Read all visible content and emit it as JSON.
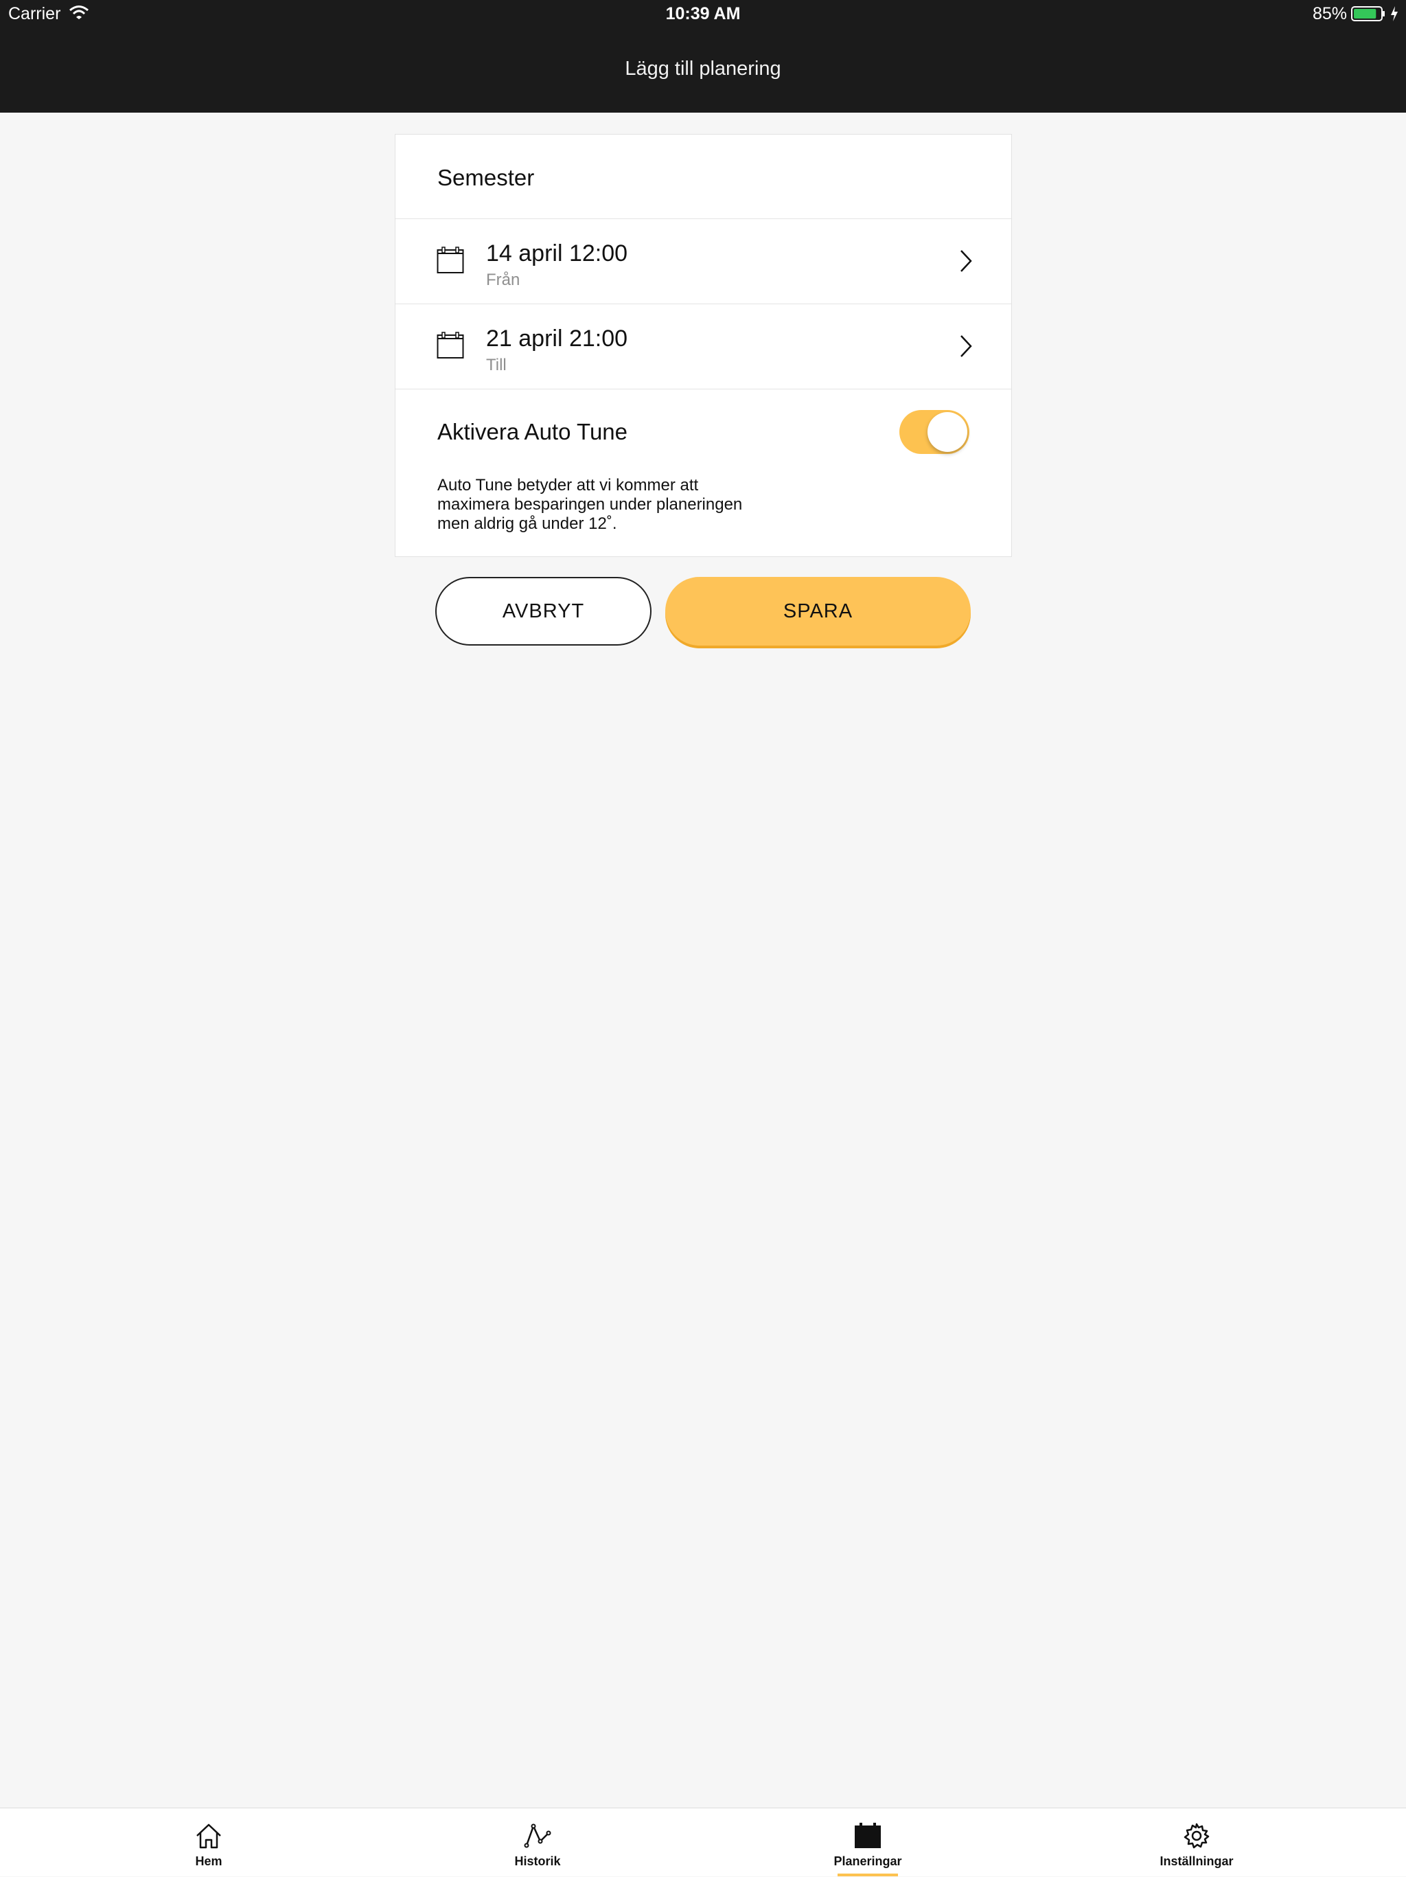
{
  "status_bar": {
    "carrier": "Carrier",
    "time": "10:39 AM",
    "battery": "85%",
    "battery_level": 0.85
  },
  "nav": {
    "title": "Lägg till planering"
  },
  "form": {
    "name": "Semester",
    "from": {
      "date": "14 april 12:00",
      "label": "Från"
    },
    "to": {
      "date": "21 april 21:00",
      "label": "Till"
    },
    "auto_tune": {
      "title": "Aktivera Auto Tune",
      "enabled": true,
      "description_lines": [
        "Auto Tune betyder att vi kommer att",
        "maximera besparingen under planeringen",
        "men aldrig gå under 12˚."
      ]
    }
  },
  "buttons": {
    "cancel": "AVBRYT",
    "save": "SPARA"
  },
  "colors": {
    "accent": "#fdc250",
    "header": "#1b1b1b",
    "background": "#f6f6f6"
  },
  "tabs": [
    {
      "label": "Hem",
      "icon": "home-icon",
      "active": false
    },
    {
      "label": "Historik",
      "icon": "history-icon",
      "active": false
    },
    {
      "label": "Planeringar",
      "icon": "calendar-icon",
      "active": true
    },
    {
      "label": "Inställningar",
      "icon": "gear-icon",
      "active": false
    }
  ]
}
